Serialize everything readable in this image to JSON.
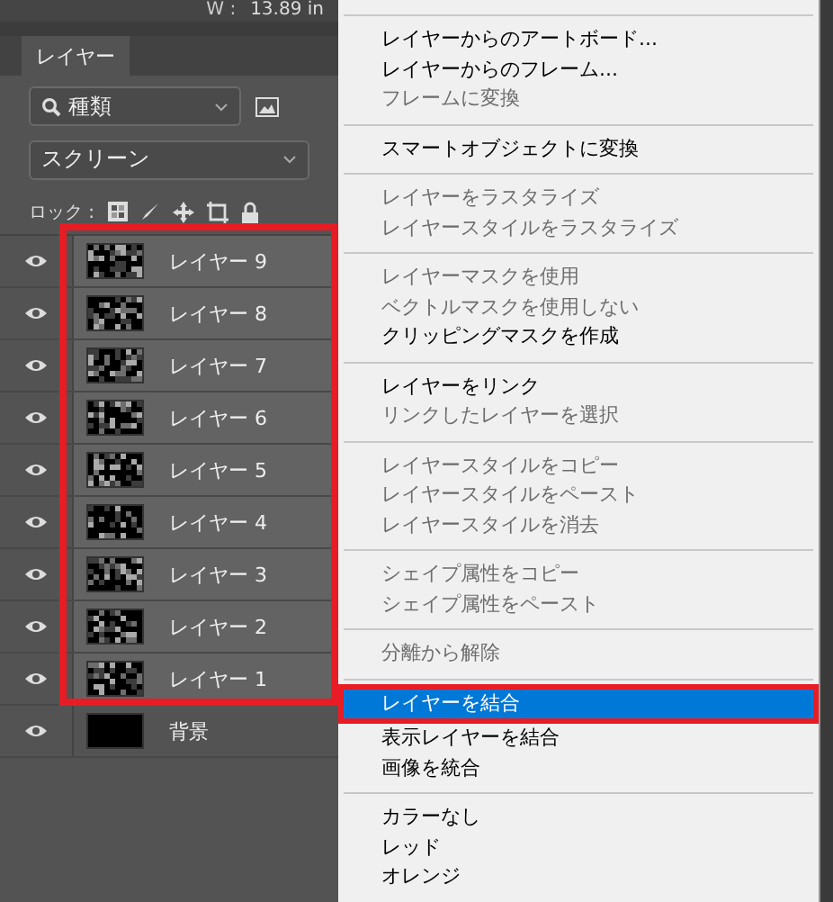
{
  "options_bar": {
    "label": "W :",
    "value": "13.89 in"
  },
  "tabs": [
    {
      "label": "レイヤー",
      "selected": true
    }
  ],
  "filter": {
    "value": "種類"
  },
  "blend_mode": {
    "value": "スクリーン"
  },
  "lock": {
    "label": "ロック :"
  },
  "layers": [
    {
      "name": "レイヤー 9",
      "visible": true,
      "kind": "pattern"
    },
    {
      "name": "レイヤー 8",
      "visible": true,
      "kind": "pattern"
    },
    {
      "name": "レイヤー 7",
      "visible": true,
      "kind": "pattern"
    },
    {
      "name": "レイヤー 6",
      "visible": true,
      "kind": "pattern"
    },
    {
      "name": "レイヤー 5",
      "visible": true,
      "kind": "pattern"
    },
    {
      "name": "レイヤー 4",
      "visible": true,
      "kind": "pattern"
    },
    {
      "name": "レイヤー 3",
      "visible": true,
      "kind": "pattern"
    },
    {
      "name": "レイヤー 2",
      "visible": true,
      "kind": "pattern"
    },
    {
      "name": "レイヤー 1",
      "visible": true,
      "kind": "pattern"
    },
    {
      "name": "背景",
      "visible": true,
      "kind": "solid"
    }
  ],
  "context_menu": {
    "groups": [
      [
        {
          "label": "レイヤーからのアートボード...",
          "disabled": false,
          "selected": false
        },
        {
          "label": "レイヤーからのフレーム...",
          "disabled": false,
          "selected": false
        },
        {
          "label": "フレームに変換",
          "disabled": true,
          "selected": false
        }
      ],
      [
        {
          "label": "スマートオブジェクトに変換",
          "disabled": false,
          "selected": false
        }
      ],
      [
        {
          "label": "レイヤーをラスタライズ",
          "disabled": true,
          "selected": false
        },
        {
          "label": "レイヤースタイルをラスタライズ",
          "disabled": true,
          "selected": false
        }
      ],
      [
        {
          "label": "レイヤーマスクを使用",
          "disabled": true,
          "selected": false
        },
        {
          "label": "ベクトルマスクを使用しない",
          "disabled": true,
          "selected": false
        },
        {
          "label": "クリッピングマスクを作成",
          "disabled": false,
          "selected": false
        }
      ],
      [
        {
          "label": "レイヤーをリンク",
          "disabled": false,
          "selected": false
        },
        {
          "label": "リンクしたレイヤーを選択",
          "disabled": true,
          "selected": false
        }
      ],
      [
        {
          "label": "レイヤースタイルをコピー",
          "disabled": true,
          "selected": false
        },
        {
          "label": "レイヤースタイルをペースト",
          "disabled": true,
          "selected": false
        },
        {
          "label": "レイヤースタイルを消去",
          "disabled": true,
          "selected": false
        }
      ],
      [
        {
          "label": "シェイプ属性をコピー",
          "disabled": true,
          "selected": false
        },
        {
          "label": "シェイプ属性をペースト",
          "disabled": true,
          "selected": false
        }
      ],
      [
        {
          "label": "分離から解除",
          "disabled": true,
          "selected": false
        }
      ],
      [
        {
          "label": "レイヤーを結合",
          "disabled": false,
          "selected": true
        },
        {
          "label": "表示レイヤーを結合",
          "disabled": false,
          "selected": false
        },
        {
          "label": "画像を統合",
          "disabled": false,
          "selected": false
        }
      ],
      [
        {
          "label": "カラーなし",
          "disabled": false,
          "selected": false
        },
        {
          "label": "レッド",
          "disabled": false,
          "selected": false
        },
        {
          "label": "オレンジ",
          "disabled": false,
          "selected": false
        }
      ]
    ]
  }
}
